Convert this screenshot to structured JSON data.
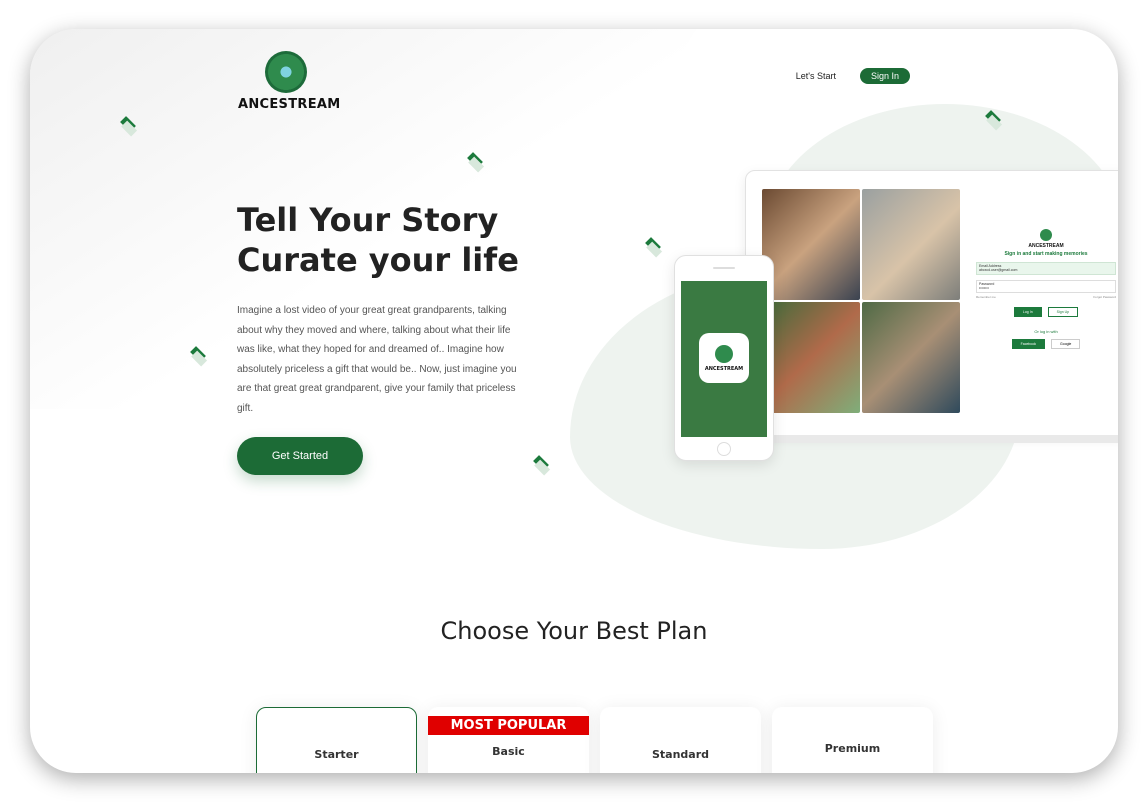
{
  "brand": {
    "name": "ANCESTREAM",
    "logo_icon": "tree-river-logo-icon"
  },
  "nav": {
    "lets_start": "Let's Start",
    "sign_in": "Sign In"
  },
  "hero": {
    "title_line1": "Tell Your Story",
    "title_line2": "Curate your life",
    "description": "Imagine a lost video of your great great grandparents, talking about why they moved and where, talking about what their life was like, what they hoped for and dreamed of.. Imagine how absolutely priceless a gift that would be.. Now, just imagine you are that great great grandparent, give your family that priceless gift.",
    "cta": "Get Started"
  },
  "mockup": {
    "brand": "ANCESTREAM",
    "heading": "Sign in and start making memories",
    "email_label": "Email Address",
    "email_value": "abcxcd.user@gmail.com",
    "password_label": "Password",
    "password_value": "••••••••",
    "remember": "Remember me",
    "forgot": "Forgot Password",
    "login": "Log In",
    "signup": "Sign Up",
    "or_login_with": "Or log in with",
    "facebook": "Facebook",
    "google": "Google",
    "phone_brand": "ANCESTREAM"
  },
  "plans": {
    "title": "Choose Your Best Plan",
    "ribbon": "MOST POPULAR",
    "items": [
      {
        "name": "Starter"
      },
      {
        "name": "Basic"
      },
      {
        "name": "Standard"
      },
      {
        "name": "Premium"
      }
    ]
  },
  "colors": {
    "brand_green": "#1c6b36",
    "ribbon_red": "#e00000"
  }
}
